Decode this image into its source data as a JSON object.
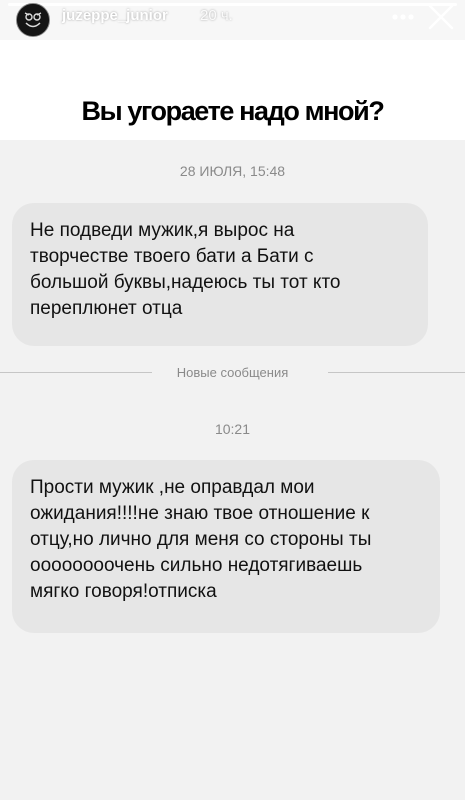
{
  "story": {
    "progress": 1.0,
    "username": "juzeppe_junior",
    "time_ago": "20 ч.",
    "more_icon": "more-horizontal-icon",
    "close_icon": "close-icon",
    "avatar_icon": "avatar-glyph-icon"
  },
  "screenshot": {
    "title": "Вы угораете надо мной?",
    "date": "28 ИЮЛЯ, 15:48",
    "divider_label": "Новые сообщения",
    "time": "10:21",
    "messages": [
      {
        "text": "Не подведи мужик,я вырос на\nтворчестве твоего бати а Бати с\nбольшой буквы,надеюсь ты тот кто\nпереплюнет отца"
      },
      {
        "text": "Прости мужик ,не оправдал мои\nожидания!!!!не знаю твое отношение к\nотцу,но лично для меня со стороны ты\nоооооооочень сильно недотягиваешь\nмягко говоря!отписка"
      }
    ]
  },
  "colors": {
    "page_bg": "#f7f7f7",
    "bubble": "#e6e6e6",
    "muted_text": "#8a8a8a",
    "title_band": "#ffffff"
  }
}
